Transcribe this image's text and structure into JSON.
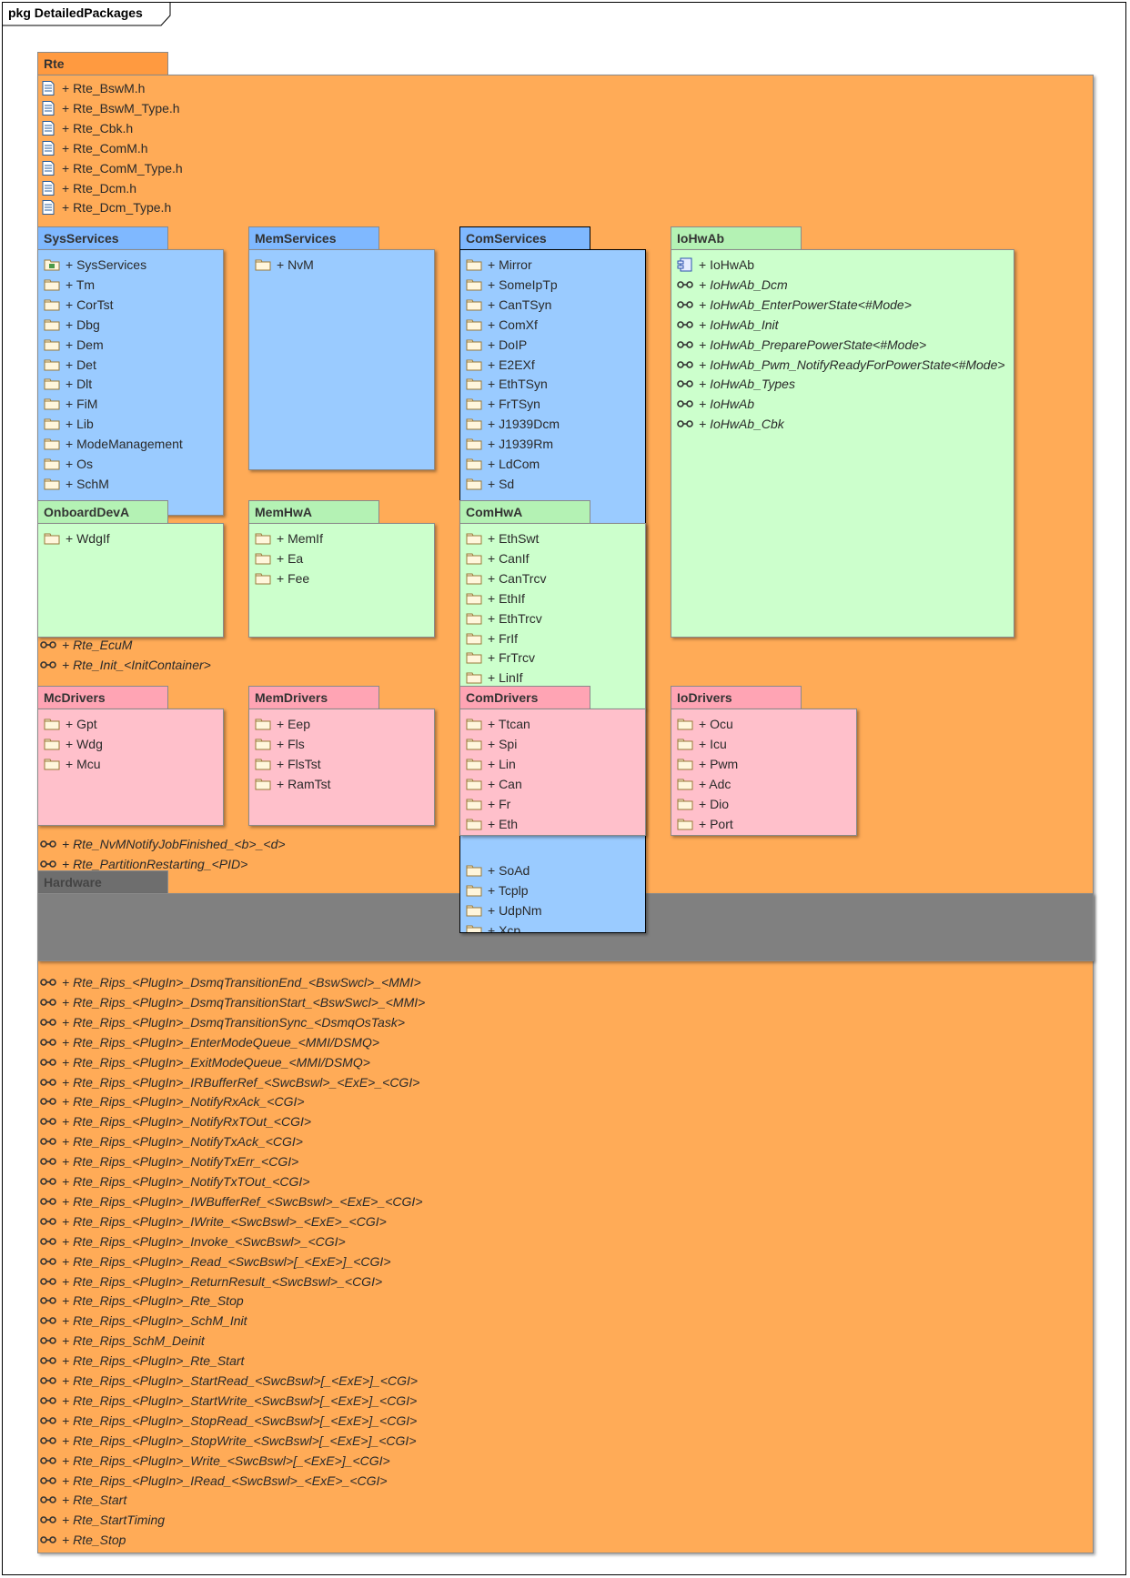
{
  "frame_title": "pkg DetailedPackages",
  "rte": {
    "name": "Rte",
    "files": [
      "+ Rte_BswM.h",
      "+ Rte_BswM_Type.h",
      "+ Rte_Cbk.h",
      "+ Rte_ComM.h",
      "+ Rte_ComM_Type.h",
      "+ Rte_Dcm.h",
      "+ Rte_Dcm_Type.h"
    ],
    "middle_interfaces": [
      "+ Rte_EcuM",
      "+ Rte_Init_<InitContainer>",
      "+ Rte_NvMNotifyJobFinished_<b>_<d>",
      "+ Rte_PartitionRestarting_<PID>"
    ],
    "lower_interfaces": [
      "+ Rte_Rips_<PlugIn>_DsmqTransitionEnd_<BswSwcl>_<MMI>",
      "+ Rte_Rips_<PlugIn>_DsmqTransitionStart_<BswSwcl>_<MMI>",
      "+ Rte_Rips_<PlugIn>_DsmqTransitionSync_<DsmqOsTask>",
      "+ Rte_Rips_<PlugIn>_EnterModeQueue_<MMI/DSMQ>",
      "+ Rte_Rips_<PlugIn>_ExitModeQueue_<MMI/DSMQ>",
      "+ Rte_Rips_<PlugIn>_IRBufferRef_<SwcBswl>_<ExE>_<CGI>",
      "+ Rte_Rips_<PlugIn>_NotifyRxAck_<CGI>",
      "+ Rte_Rips_<PlugIn>_NotifyRxTOut_<CGI>",
      "+ Rte_Rips_<PlugIn>_NotifyTxAck_<CGI>",
      "+ Rte_Rips_<PlugIn>_NotifyTxErr_<CGI>",
      "+ Rte_Rips_<PlugIn>_NotifyTxTOut_<CGI>",
      "+ Rte_Rips_<PlugIn>_IWBufferRef_<SwcBswl>_<ExE>_<CGI>",
      "+ Rte_Rips_<PlugIn>_IWrite_<SwcBswl>_<ExE>_<CGI>",
      "+ Rte_Rips_<PlugIn>_Invoke_<SwcBswl>_<CGI>",
      "+ Rte_Rips_<PlugIn>_Read_<SwcBswl>[_<ExE>]_<CGI>",
      "+ Rte_Rips_<PlugIn>_ReturnResult_<SwcBswl>_<CGI>",
      "+ Rte_Rips_<PlugIn>_Rte_Stop",
      "+ Rte_Rips_<PlugIn>_SchM_Init",
      "+ Rte_Rips_SchM_Deinit",
      "+ Rte_Rips_<PlugIn>_Rte_Start",
      "+ Rte_Rips_<PlugIn>_StartRead_<SwcBswl>[_<ExE>]_<CGI>",
      "+ Rte_Rips_<PlugIn>_StartWrite_<SwcBswl>[_<ExE>]_<CGI>",
      "+ Rte_Rips_<PlugIn>_StopRead_<SwcBswl>[_<ExE>]_<CGI>",
      "+ Rte_Rips_<PlugIn>_StopWrite_<SwcBswl>[_<ExE>]_<CGI>",
      "+ Rte_Rips_<PlugIn>_Write_<SwcBswl>[_<ExE>]_<CGI>",
      "+ Rte_Rips_<PlugIn>_IRead_<SwcBswl>_<ExE>_<CGI>",
      "+ Rte_Start",
      "+ Rte_StartTiming",
      "+ Rte_Stop"
    ]
  },
  "hardware": {
    "name": "Hardware"
  },
  "sys_services": {
    "name": "SysServices",
    "items": [
      "+ SysServices",
      "+ Tm",
      "+ CorTst",
      "+ Dbg",
      "+ Dem",
      "+ Det",
      "+ Dlt",
      "+ FiM",
      "+ Lib",
      "+ ModeManagement",
      "+ Os",
      "+ SchM"
    ]
  },
  "mem_services": {
    "name": "MemServices",
    "items": [
      "+ NvM"
    ]
  },
  "com_services": {
    "name": "ComServices",
    "items": [
      "+ Mirror",
      "+ SomeIpTp",
      "+ CanTSyn",
      "+ ComXf",
      "+ DoIP",
      "+ E2EXf",
      "+ EthTSyn",
      "+ FrTSyn",
      "+ J1939Dcm",
      "+ J1939Rm",
      "+ LdCom",
      "+ Sd"
    ],
    "lower_items": [
      "+ SoAd",
      "+ Tcplp",
      "+ UdpNm",
      "+ Xcp"
    ]
  },
  "io_hw_ab": {
    "name": "IoHwAb",
    "items": [
      "+ IoHwAb",
      "+ IoHwAb_Dcm",
      "+ IoHwAb_EnterPowerState<#Mode>",
      "+ IoHwAb_Init",
      "+ IoHwAb_PreparePowerState<#Mode>",
      "+ IoHwAb_Pwm_NotifyReadyForPowerState<#Mode>",
      "+ IoHwAb_Types",
      "+ IoHwAb",
      "+ IoHwAb_Cbk"
    ]
  },
  "onboard_dev_a": {
    "name": "OnboardDevA",
    "items": [
      "+ WdgIf"
    ]
  },
  "mem_hw_a": {
    "name": "MemHwA",
    "items": [
      "+ MemIf",
      "+ Ea",
      "+ Fee"
    ]
  },
  "com_hw_a": {
    "name": "ComHwA",
    "items": [
      "+ EthSwt",
      "+ CanIf",
      "+ CanTrcv",
      "+ EthIf",
      "+ EthTrcv",
      "+ FrIf",
      "+ FrTrcv",
      "+ LinIf"
    ]
  },
  "mc_drivers": {
    "name": "McDrivers",
    "items": [
      "+ Gpt",
      "+ Wdg",
      "+ Mcu"
    ]
  },
  "mem_drivers": {
    "name": "MemDrivers",
    "items": [
      "+ Eep",
      "+ Fls",
      "+ FlsTst",
      "+ RamTst"
    ]
  },
  "com_drivers": {
    "name": "ComDrivers",
    "items": [
      "+ Ttcan",
      "+ Spi",
      "+ Lin",
      "+ Can",
      "+ Fr",
      "+ Eth"
    ]
  },
  "io_drivers": {
    "name": "IoDrivers",
    "items": [
      "+ Ocu",
      "+ Icu",
      "+ Pwm",
      "+ Adc",
      "+ Dio",
      "+ Port"
    ]
  },
  "colors": {
    "rte": "#ffab57",
    "services": "#9acbff",
    "hw_abstraction": "#ccffcc",
    "drivers": "#ffc0cb",
    "hardware": "#808080"
  }
}
